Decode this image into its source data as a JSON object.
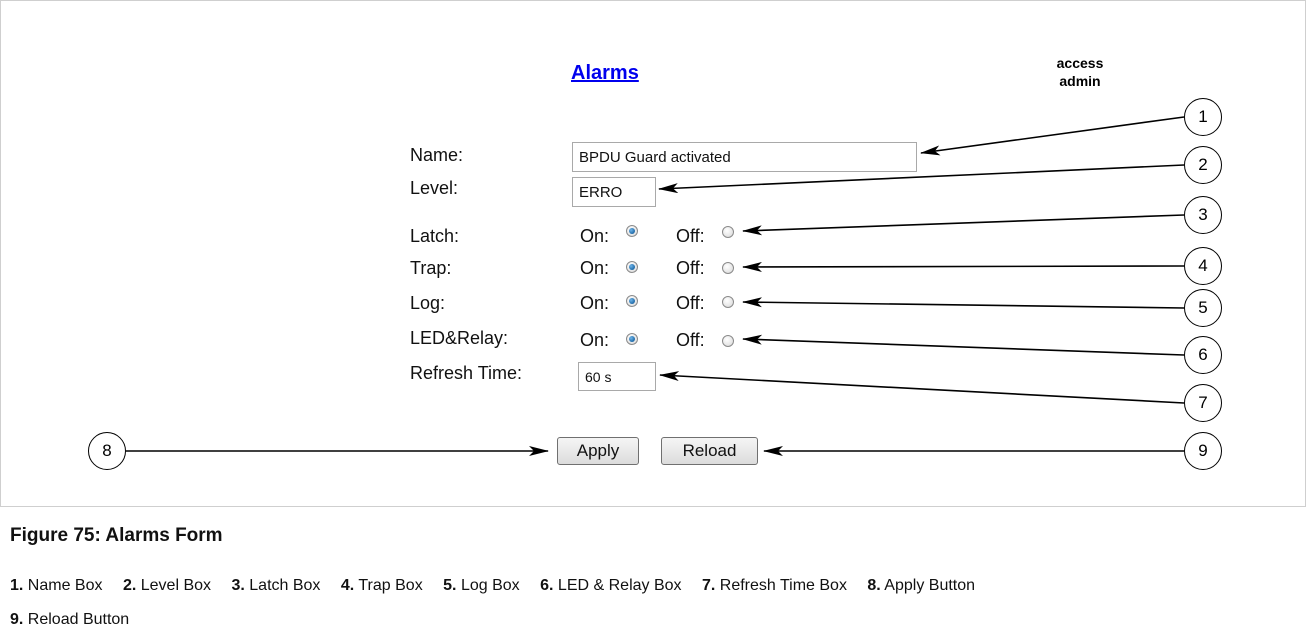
{
  "form": {
    "title": "Alarms",
    "access_line1": "access",
    "access_line2": "admin",
    "fields": {
      "name": {
        "label": "Name:",
        "value": "BPDU Guard activated"
      },
      "level": {
        "label": "Level:",
        "value": "ERRO"
      },
      "latch": {
        "label": "Latch:",
        "on_label": "On:",
        "off_label": "Off:",
        "selected": "On"
      },
      "trap": {
        "label": "Trap:",
        "on_label": "On:",
        "off_label": "Off:",
        "selected": "On"
      },
      "log": {
        "label": "Log:",
        "on_label": "On:",
        "off_label": "Off:",
        "selected": "On"
      },
      "led_relay": {
        "label": "LED&Relay:",
        "on_label": "On:",
        "off_label": "Off:",
        "selected": "On"
      },
      "refresh_time": {
        "label": "Refresh Time:",
        "value": "60 s"
      }
    },
    "buttons": {
      "apply": "Apply",
      "reload": "Reload"
    }
  },
  "callouts": [
    "1",
    "2",
    "3",
    "4",
    "5",
    "6",
    "7",
    "8",
    "9"
  ],
  "caption": {
    "title": "Figure 75: Alarms Form",
    "legend": [
      {
        "num": "1.",
        "text": "Name Box"
      },
      {
        "num": "2.",
        "text": "Level Box"
      },
      {
        "num": "3.",
        "text": "Latch Box"
      },
      {
        "num": "4.",
        "text": "Trap Box"
      },
      {
        "num": "5.",
        "text": "Log Box"
      },
      {
        "num": "6.",
        "text": "LED & Relay Box"
      },
      {
        "num": "7.",
        "text": "Refresh Time Box"
      },
      {
        "num": "8.",
        "text": "Apply Button"
      },
      {
        "num": "9.",
        "text": "Reload Button"
      }
    ]
  },
  "colors": {
    "link": "#0000ee",
    "radio_selected": "#1f6aa8",
    "frame_border": "#cfcfcf"
  }
}
